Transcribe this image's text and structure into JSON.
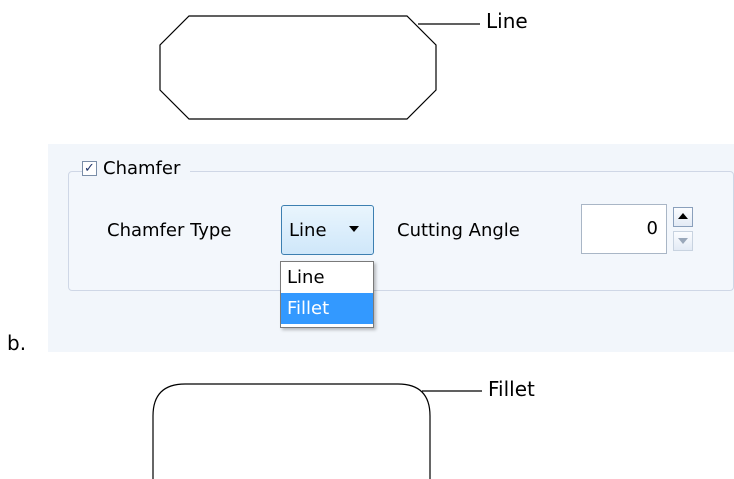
{
  "top_diagram": {
    "label": "Line"
  },
  "bottom_diagram": {
    "label": "Fillet"
  },
  "caption": "b.",
  "chamfer_group": {
    "checkbox_label": "Chamfer",
    "checked": true,
    "chamfer_type_label": "Chamfer Type",
    "chamfer_type_value": "Line",
    "dropdown_options": [
      "Line",
      "Fillet"
    ],
    "dropdown_highlighted": "Fillet",
    "cutting_angle_label": "Cutting Angle",
    "cutting_angle_value": "0"
  },
  "colors": {
    "panel_bg": "#f2f6fb",
    "combo_border": "#3c7fb1",
    "selection": "#3399ff"
  },
  "icons": {
    "check": "checkmark-icon",
    "combo_arrow": "chevron-down-icon",
    "spin_up": "triangle-up-icon",
    "spin_down": "triangle-down-icon"
  }
}
